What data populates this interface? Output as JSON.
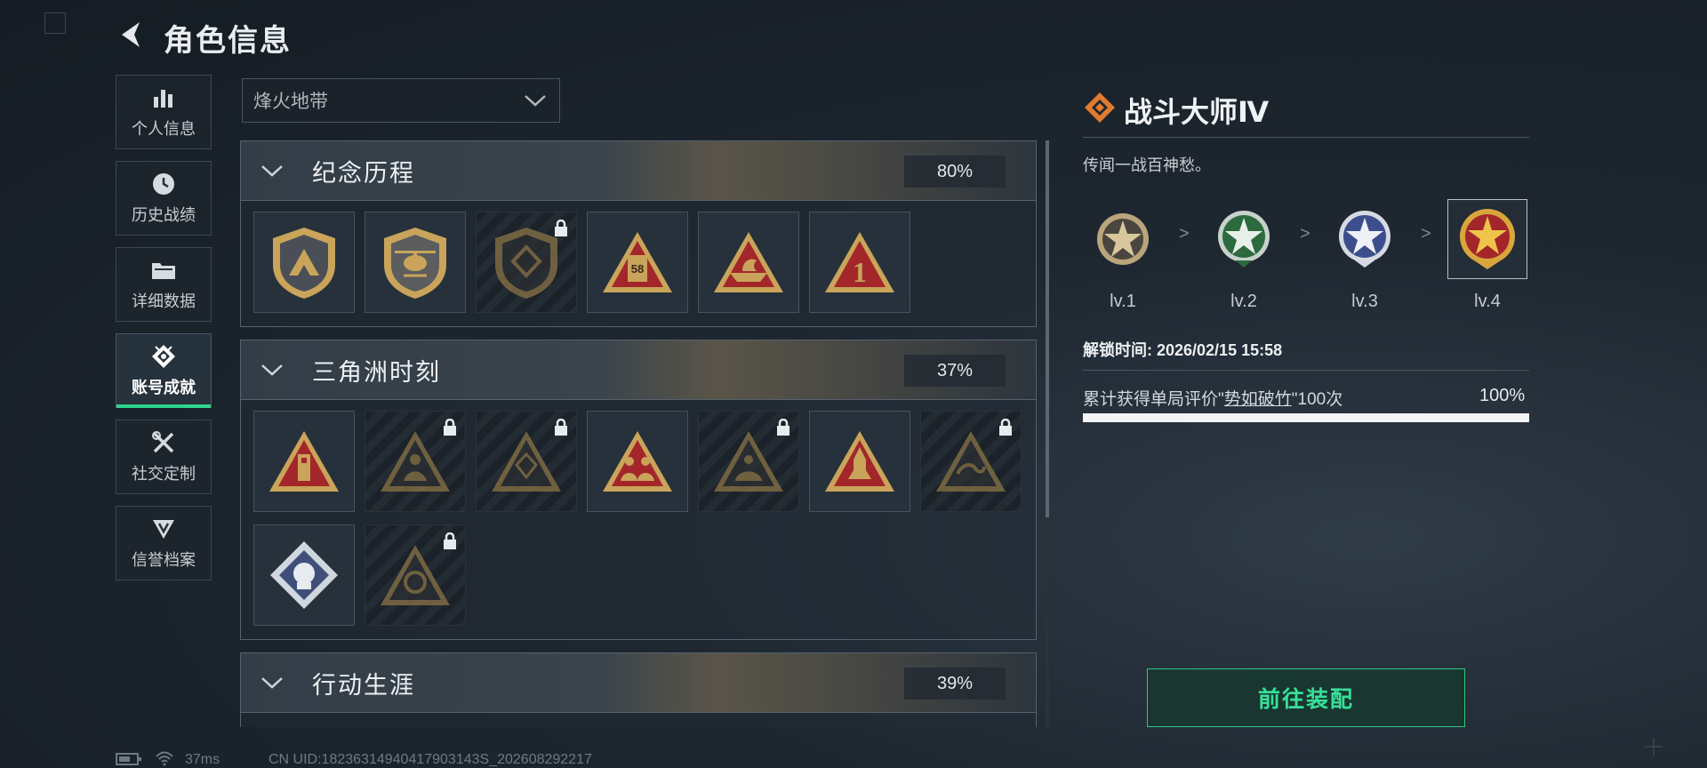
{
  "header": {
    "title": "角色信息",
    "back_icon": "back-arrow-icon"
  },
  "sidebar": {
    "items": [
      {
        "label": "个人信息",
        "icon": "bar-chart-icon",
        "active": false
      },
      {
        "label": "历史战绩",
        "icon": "clock-icon",
        "active": false
      },
      {
        "label": "详细数据",
        "icon": "folder-icon",
        "active": false
      },
      {
        "label": "账号成就",
        "icon": "achievement-icon",
        "active": true
      },
      {
        "label": "社交定制",
        "icon": "tools-icon",
        "active": false
      },
      {
        "label": "信誉档案",
        "icon": "reputation-icon",
        "active": false
      }
    ]
  },
  "mode_select": {
    "value": "烽火地带"
  },
  "categories": [
    {
      "name": "纪念历程",
      "percent": "80%"
    },
    {
      "name": "三角洲时刻",
      "percent": "37%"
    },
    {
      "name": "行动生涯",
      "percent": "39%"
    }
  ],
  "detail": {
    "title": "战斗大师Ⅳ",
    "description": "传闻一战百神愁。",
    "levels": [
      "lv.1",
      "lv.2",
      "lv.3",
      "lv.4"
    ],
    "level_separator": ">",
    "unlock_time": "解锁时间: 2026/02/15 15:58",
    "requirement_prefix": "累计获得单局评价\"",
    "requirement_link": "势如破竹",
    "requirement_suffix": "\"100次",
    "progress_text": "100%",
    "progress": 1.0
  },
  "equip_button": "前往装配",
  "footer": {
    "ping": "37ms",
    "uid": "CN UID:18236314940417903143S_202608292217"
  },
  "colors": {
    "accent": "#2fd48e",
    "medal_gold": "#c9a45a",
    "medal_red": "#a3272a"
  }
}
